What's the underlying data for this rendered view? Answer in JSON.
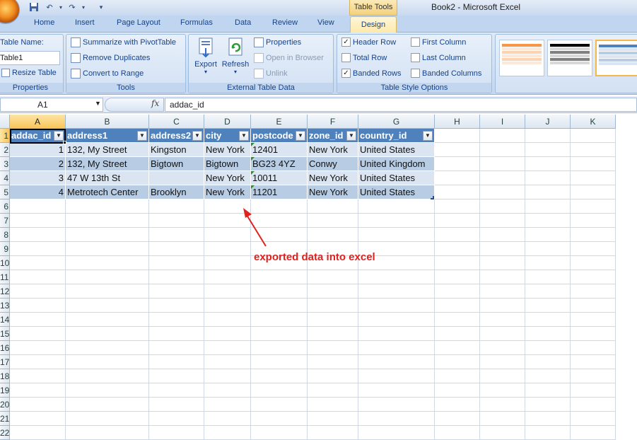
{
  "window": {
    "title": "Book2 - Microsoft Excel",
    "context_tab": "Table Tools"
  },
  "tabs": [
    "Home",
    "Insert",
    "Page Layout",
    "Formulas",
    "Data",
    "Review",
    "View",
    "Design"
  ],
  "ribbon": {
    "properties": {
      "label": "Properties",
      "table_name_label": "Table Name:",
      "table_name_value": "Table1",
      "resize_label": "Resize Table"
    },
    "tools": {
      "label": "Tools",
      "summarize": "Summarize with PivotTable",
      "remove_duplicates": "Remove Duplicates",
      "convert": "Convert to Range"
    },
    "external": {
      "label": "External Table Data",
      "export": "Export",
      "refresh": "Refresh",
      "properties": "Properties",
      "open_browser": "Open in Browser",
      "unlink": "Unlink"
    },
    "style_options": {
      "label": "Table Style Options",
      "header_row": {
        "label": "Header Row",
        "checked": true
      },
      "total_row": {
        "label": "Total Row",
        "checked": false
      },
      "banded_rows": {
        "label": "Banded Rows",
        "checked": true
      },
      "first_column": {
        "label": "First Column",
        "checked": false
      },
      "last_column": {
        "label": "Last Column",
        "checked": false
      },
      "banded_columns": {
        "label": "Banded Columns",
        "checked": false
      }
    },
    "style_colors": [
      "#f79646",
      "#000000",
      "#4f81bd"
    ]
  },
  "formula_bar": {
    "name_box": "A1",
    "fx": "fx",
    "formula": "addac_id"
  },
  "columns": [
    "A",
    "B",
    "C",
    "D",
    "E",
    "F",
    "G",
    "H",
    "I",
    "J",
    "K"
  ],
  "row_numbers": [
    "1",
    "2",
    "3",
    "4",
    "5",
    "6",
    "7",
    "8",
    "9",
    "10",
    "11",
    "12",
    "13",
    "14",
    "15",
    "16",
    "17",
    "18",
    "19",
    "20",
    "21",
    "22"
  ],
  "table": {
    "headers": [
      "addac_id",
      "address1",
      "address2",
      "city",
      "postcode",
      "zone_id",
      "country_id"
    ],
    "rows": [
      [
        "1",
        "132, My Street",
        "Kingston",
        "New York",
        "12401",
        "New York",
        "United States"
      ],
      [
        "2",
        "132, My Street",
        "Bigtown",
        "Bigtown",
        "BG23 4YZ",
        "Conwy",
        "United Kingdom"
      ],
      [
        "3",
        "47 W 13th St",
        "",
        "New York",
        "10011",
        "New York",
        "United States"
      ],
      [
        "4",
        "Metrotech Center",
        "Brooklyn",
        "New York",
        "11201",
        "New York",
        "United States"
      ]
    ]
  },
  "annotation": "exported data into excel"
}
